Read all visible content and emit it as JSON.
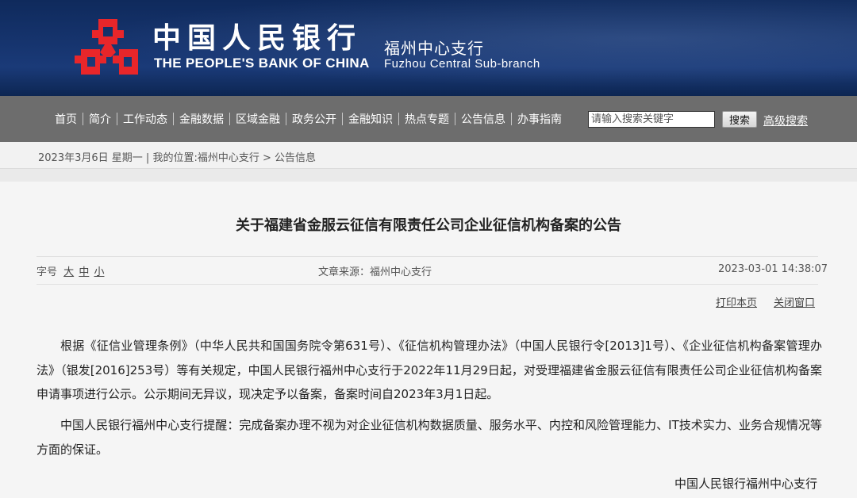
{
  "header": {
    "bank_name_cn": "中国人民银行",
    "bank_name_en": "THE PEOPLE'S BANK OF CHINA",
    "branch_cn": "福州中心支行",
    "branch_en": "Fuzhou  Central  Sub-branch",
    "logo_color": "#e8262a"
  },
  "nav": {
    "items": [
      "首页",
      "简介",
      "工作动态",
      "金融数据",
      "区域金融",
      "政务公开",
      "金融知识",
      "热点专题",
      "公告信息",
      "办事指南"
    ],
    "search_placeholder": "请输入搜索关键字",
    "search_button": "搜索",
    "advanced_search": "高级搜索"
  },
  "breadcrumb": {
    "date": "2023年3月6日 星期一",
    "separator": "|",
    "location_label": "我的位置:",
    "items": [
      "福州中心支行",
      "公告信息"
    ],
    "arrow": ">"
  },
  "article": {
    "title": "关于福建省金服云征信有限责任公司企业征信机构备案的公告",
    "font_size_label": "字号",
    "font_sizes": [
      "大",
      "中",
      "小"
    ],
    "source_label": "文章来源：",
    "source": "福州中心支行",
    "datetime": "2023-03-01 14:38:07",
    "print_link": "打印本页",
    "close_link": "关闭窗口",
    "paragraphs": [
      "根据《征信业管理条例》（中华人民共和国国务院令第631号）、《征信机构管理办法》（中国人民银行令[2013]1号）、《企业征信机构备案管理办法》（银发[2016]253号）等有关规定，中国人民银行福州中心支行于2022年11月29日起，对受理福建省金服云征信有限责任公司企业征信机构备案申请事项进行公示。公示期间无异议，现决定予以备案，备案时间自2023年3月1日起。",
      "中国人民银行福州中心支行提醒：完成备案办理不视为对企业征信机构数据质量、服务水平、内控和风险管理能力、IT技术实力、业务合规情况等方面的保证。"
    ],
    "signature": "中国人民银行福州中心支行"
  },
  "colors": {
    "banner": "#16346e",
    "nav_bg": "#6d6d6d",
    "crumb_bg": "#f2f2f2",
    "content_bg": "#f5f5f5"
  }
}
